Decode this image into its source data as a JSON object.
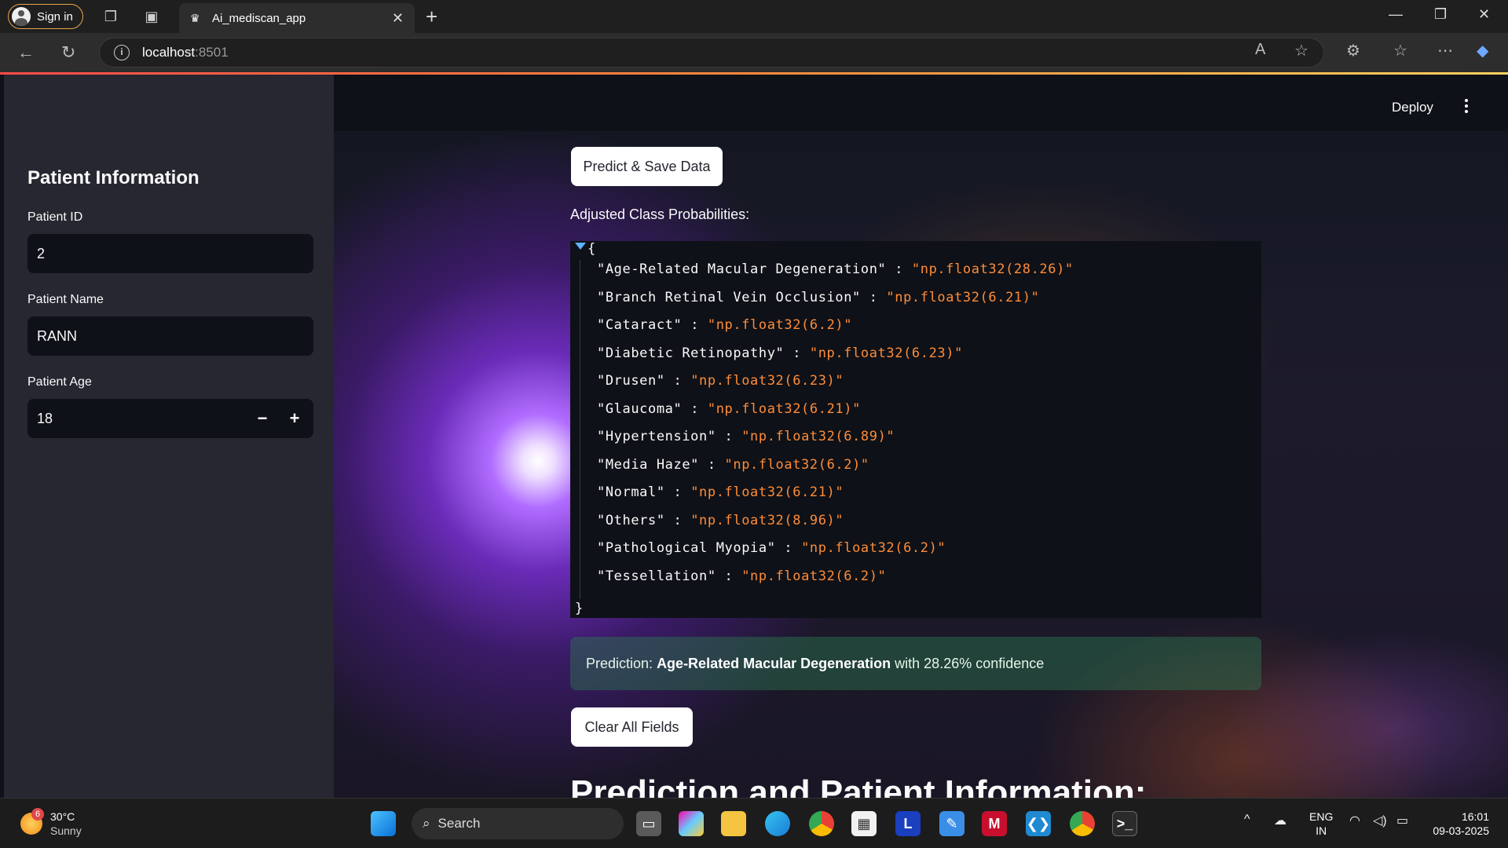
{
  "browser": {
    "signin_label": "Sign in",
    "tab_title": "Ai_mediscan_app",
    "url_host": "localhost",
    "url_port": ":8501"
  },
  "app": {
    "deploy_label": "Deploy",
    "sidebar": {
      "title": "Patient Information",
      "patient_id_label": "Patient ID",
      "patient_id_value": "2",
      "patient_name_label": "Patient Name",
      "patient_name_value": "RANN",
      "patient_age_label": "Patient Age",
      "patient_age_value": "18",
      "minus_label": "−",
      "plus_label": "+"
    },
    "predict_button_label": "Predict & Save Data",
    "probs_label": "Adjusted Class Probabilities:",
    "json_open": "{",
    "json_close": "}",
    "probabilities": [
      {
        "key": "\"Age-Related Macular Degeneration\"",
        "value": "\"np.float32(28.26)\""
      },
      {
        "key": "\"Branch Retinal Vein Occlusion\"",
        "value": "\"np.float32(6.21)\""
      },
      {
        "key": "\"Cataract\"",
        "value": "\"np.float32(6.2)\""
      },
      {
        "key": "\"Diabetic Retinopathy\"",
        "value": "\"np.float32(6.23)\""
      },
      {
        "key": "\"Drusen\"",
        "value": "\"np.float32(6.23)\""
      },
      {
        "key": "\"Glaucoma\"",
        "value": "\"np.float32(6.21)\""
      },
      {
        "key": "\"Hypertension\"",
        "value": "\"np.float32(6.89)\""
      },
      {
        "key": "\"Media Haze\"",
        "value": "\"np.float32(6.2)\""
      },
      {
        "key": "\"Normal\"",
        "value": "\"np.float32(6.21)\""
      },
      {
        "key": "\"Others\"",
        "value": "\"np.float32(8.96)\""
      },
      {
        "key": "\"Pathological Myopia\"",
        "value": "\"np.float32(6.2)\""
      },
      {
        "key": "\"Tessellation\"",
        "value": "\"np.float32(6.2)\""
      }
    ],
    "prediction": {
      "prefix": "Prediction: ",
      "disease": "Age-Related Macular Degeneration",
      "suffix": " with 28.26% confidence"
    },
    "clear_button_label": "Clear All Fields",
    "section_heading": "Prediction and Patient Information:"
  },
  "taskbar": {
    "weather_temp": "30°C",
    "weather_desc": "Sunny",
    "weather_badge": "6",
    "search_label": "Search",
    "lang_top": "ENG",
    "lang_bottom": "IN",
    "time": "16:01",
    "date": "09-03-2025"
  },
  "colors": {
    "accent": "#ff4b4b",
    "json_value": "#ff8c38",
    "success_bg": "#2d7850"
  }
}
